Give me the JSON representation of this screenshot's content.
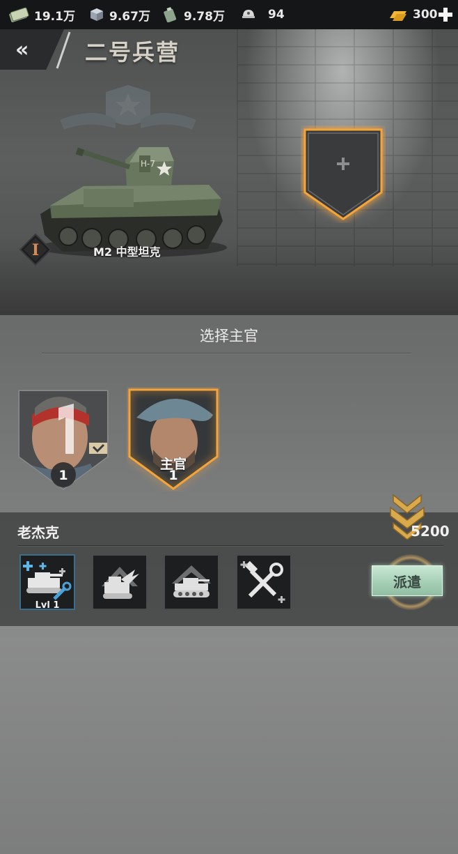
{
  "resources": [
    {
      "icon": "cash-icon",
      "value": "19.1万"
    },
    {
      "icon": "steel-icon",
      "value": "9.67万"
    },
    {
      "icon": "fuel-icon",
      "value": "9.78万"
    },
    {
      "icon": "helmet-icon",
      "value": "94"
    },
    {
      "icon": "gold-icon",
      "value": "300"
    }
  ],
  "header": {
    "back_label": "«",
    "title": "二号兵营"
  },
  "tank": {
    "name": "M2 中型坦克",
    "tier": "I"
  },
  "select_section": {
    "title": "选择主官"
  },
  "officers": [
    {
      "level": "1",
      "label": "",
      "selected": false
    },
    {
      "level": "1",
      "label": "主官",
      "selected": true
    }
  ],
  "detail": {
    "name": "老杰克",
    "cost": "5200",
    "skills": [
      {
        "icon": "tank-repair-icon",
        "level_label": "Lvl 1"
      },
      {
        "icon": "tank-strike-icon",
        "level_label": ""
      },
      {
        "icon": "tank-armor-icon",
        "level_label": ""
      },
      {
        "icon": "tools-icon",
        "level_label": ""
      }
    ],
    "dispatch_label": "派遣"
  },
  "colors": {
    "gold": "#f3b733",
    "glow": "#f5a43a",
    "dispatch": "#a6cfb6"
  }
}
